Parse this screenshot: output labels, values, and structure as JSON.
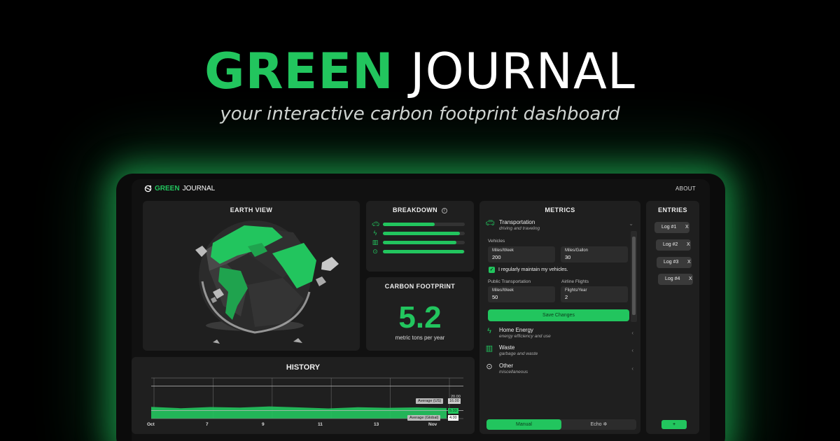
{
  "hero": {
    "title_green": "GREEN",
    "title_white": "JOURNAL",
    "subtitle": "your interactive carbon footprint dashboard"
  },
  "app": {
    "logo_green": "GREEN",
    "logo_white": "JOURNAL",
    "about": "ABOUT"
  },
  "earth_view": {
    "title": "EARTH VIEW"
  },
  "breakdown": {
    "title": "BREAKDOWN",
    "info_icon": "info-icon",
    "items": [
      {
        "icon": "car-icon",
        "fill": 0.63
      },
      {
        "icon": "bolt-icon",
        "fill": 0.94
      },
      {
        "icon": "trash-icon",
        "fill": 0.9
      },
      {
        "icon": "dots-icon",
        "fill": 0.99
      }
    ]
  },
  "footprint": {
    "title": "CARBON FOOTPRINT",
    "value": "5.2",
    "unit": "metric tons per year"
  },
  "history": {
    "title": "HISTORY",
    "x_ticks": [
      "Oct",
      "7",
      "9",
      "11",
      "13",
      "Nov"
    ],
    "avg_us_label": "Average (US)",
    "avg_us_value": "16.00",
    "avg_us_top": "20.00",
    "current_value": "5.33",
    "avg_global_label": "Average (Global)",
    "avg_global_value": "4.00",
    "accent": "#22c55e"
  },
  "chart_data": {
    "type": "area",
    "x": [
      "Oct",
      "7",
      "9",
      "11",
      "13",
      "Nov"
    ],
    "series": [
      {
        "values": [
          5.8,
          5.1,
          5.7,
          5.4,
          6.0,
          5.5,
          5.0,
          5.6,
          5.3,
          5.5,
          5.2
        ]
      }
    ],
    "reference_lines": [
      {
        "name": "Average (US)",
        "value": 16.0
      },
      {
        "name": "Average (Global)",
        "value": 4.0
      }
    ],
    "ylim": [
      0,
      20
    ]
  },
  "metrics": {
    "title": "METRICS",
    "transportation": {
      "name": "Transportation",
      "sub": "driving and traveling",
      "vehicles_label": "Vehicles",
      "miles_week_label": "Miles/Week",
      "miles_week_value": "200",
      "mpg_label": "Miles/Gallon",
      "mpg_value": "30",
      "maintain_label": "I regularly maintain my vehicles.",
      "public_label": "Public Transportation",
      "public_miles_label": "Miles/Week",
      "public_miles_value": "50",
      "flights_label": "Airline Flights",
      "flights_year_label": "Flights/Year",
      "flights_year_value": "2",
      "save": "Save Changes"
    },
    "home": {
      "name": "Home Energy",
      "sub": "energy efficiency and use"
    },
    "waste": {
      "name": "Waste",
      "sub": "garbage and waste"
    },
    "other": {
      "name": "Other",
      "sub": "miscellaneous"
    },
    "mode_manual": "Manual",
    "mode_echo": "Echo"
  },
  "entries": {
    "title": "ENTRIES",
    "items": [
      "Log #1",
      "Log #2",
      "Log #3",
      "Log #4"
    ],
    "remove": "X",
    "add": "+"
  }
}
